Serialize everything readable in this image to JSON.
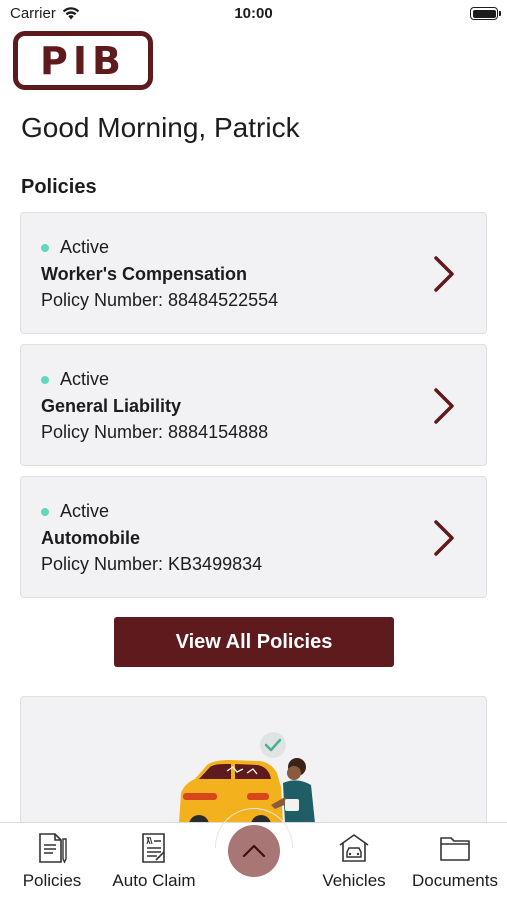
{
  "status_bar": {
    "carrier": "Carrier",
    "time": "10:00"
  },
  "logo": {
    "text": "PIB"
  },
  "greeting": "Good Morning, Patrick",
  "section_title": "Policies",
  "policies": [
    {
      "status": "Active",
      "name": "Worker's Compensation",
      "number": "Policy Number: 88484522554"
    },
    {
      "status": "Active",
      "name": "General Liability",
      "number": "Policy Number: 8884154888"
    },
    {
      "status": "Active",
      "name": "Automobile",
      "number": "Policy Number: KB3499834"
    }
  ],
  "view_all_label": "View All Policies",
  "tabs": [
    {
      "label": "Policies",
      "icon": "policies-doc-icon"
    },
    {
      "label": "Auto Claim",
      "icon": "auto-claim-icon"
    },
    {
      "label": "",
      "icon": "chevron-up-icon"
    },
    {
      "label": "Vehicles",
      "icon": "vehicles-icon"
    },
    {
      "label": "Documents",
      "icon": "folder-icon"
    }
  ],
  "colors": {
    "brand": "#5e1a1d",
    "active_dot": "#5fd8bf",
    "card_bg": "#f2f2f4",
    "center_button": "#a97676"
  }
}
